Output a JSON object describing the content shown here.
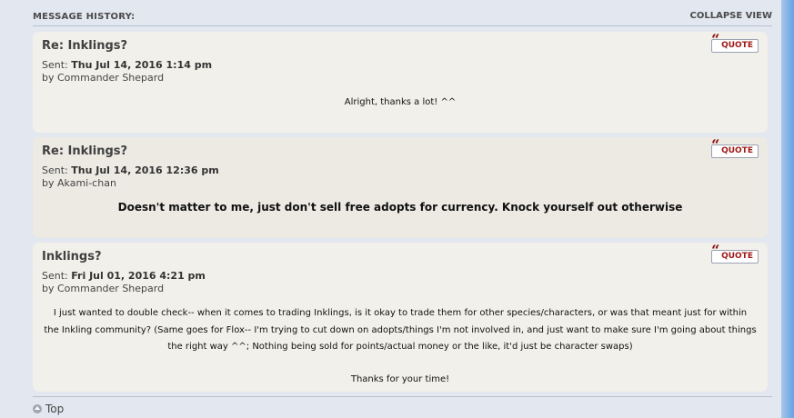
{
  "history": {
    "title": "MESSAGE HISTORY:",
    "collapse_label": "COLLAPSE VIEW"
  },
  "posts": [
    {
      "title": "Re: Inklings?",
      "sent_label": "Sent:",
      "sent_date": "Thu Jul 14, 2016 1:14 pm",
      "by_label": "by",
      "author": "Commander Shepard",
      "quote_label": "QUOTE",
      "body": "Alright, thanks a lot! ^^"
    },
    {
      "title": "Re: Inklings?",
      "sent_label": "Sent:",
      "sent_date": "Thu Jul 14, 2016 12:36 pm",
      "by_label": "by",
      "author": "Akami-chan",
      "quote_label": "QUOTE",
      "body": "Doesn't matter to me, just don't sell free adopts for currency. Knock yourself out otherwise"
    },
    {
      "title": "Inklings?",
      "sent_label": "Sent:",
      "sent_date": "Fri Jul 01, 2016 4:21 pm",
      "by_label": "by",
      "author": "Commander Shepard",
      "quote_label": "QUOTE",
      "body_lines": [
        "I just wanted to double check-- when it comes to trading Inklings, is it okay to trade them for other species/characters, or was that meant just for within",
        "the Inkling community? (Same goes for Flox-- I'm trying to cut down on adopts/things I'm not involved in, and just want to make sure I'm going about things",
        "the right way ^^; Nothing being sold for points/actual money or the like, it'd just be character swaps)"
      ],
      "body_thanks": "Thanks for your time!"
    }
  ],
  "footer": {
    "top_label": "Top"
  }
}
